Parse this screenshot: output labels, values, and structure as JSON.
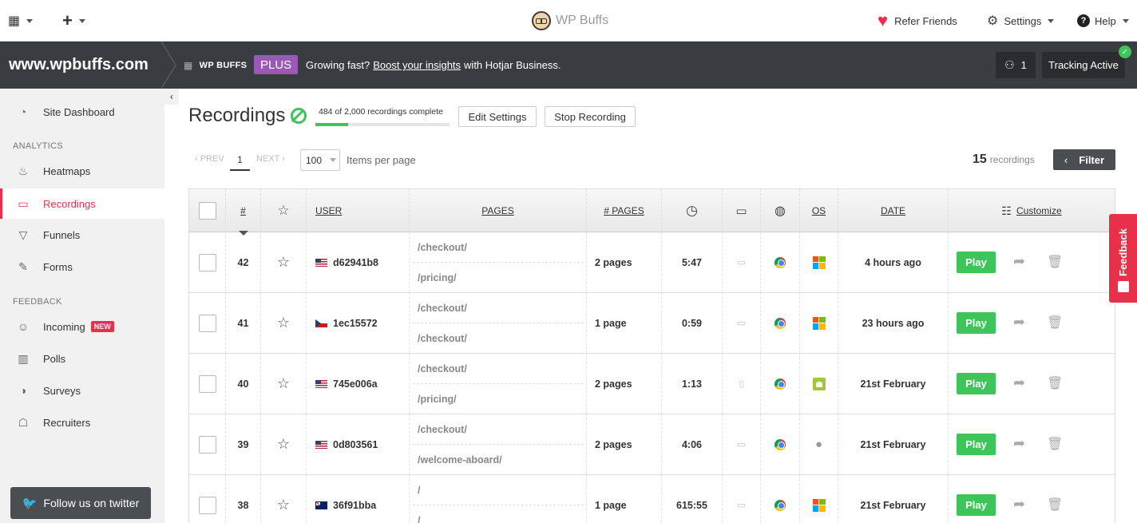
{
  "topbar": {
    "logo_text": "WP Buffs",
    "refer_label": "Refer Friends",
    "settings_label": "Settings",
    "help_label": "Help"
  },
  "sitebar": {
    "site_name": "www.wpbuffs.com",
    "org_name": "WP BUFFS",
    "plan_badge": "PLUS",
    "promo_prefix": "Growing fast?",
    "promo_link": "Boost your insights",
    "promo_suffix": "with Hotjar Business.",
    "active_users": "1",
    "tracking_label": "Tracking Active"
  },
  "sidebar": {
    "dashboard": "Site Dashboard",
    "analytics_head": "ANALYTICS",
    "heatmaps": "Heatmaps",
    "recordings": "Recordings",
    "funnels": "Funnels",
    "forms": "Forms",
    "feedback_head": "FEEDBACK",
    "incoming": "Incoming",
    "new_badge": "NEW",
    "polls": "Polls",
    "surveys": "Surveys",
    "recruiters": "Recruiters",
    "twitter": "Follow us on twitter"
  },
  "main": {
    "title": "Recordings",
    "progress_text": "484 of 2,000 recordings complete",
    "progress_fraction": 0.242,
    "edit_settings": "Edit Settings",
    "stop_recording": "Stop Recording"
  },
  "pagination": {
    "prev": "‹ PREV",
    "page": "1",
    "next": "NEXT ›",
    "per_page": "100",
    "per_page_label": "Items per page",
    "count": "15",
    "count_label": "recordings",
    "filter": "Filter"
  },
  "table": {
    "headers": {
      "num": "#",
      "user": "USER",
      "pages": "PAGES",
      "num_pages": "# PAGES",
      "os": "OS",
      "date": "DATE",
      "customize": "Customize"
    },
    "play_label": "Play",
    "rows": [
      {
        "num": "42",
        "flag": "us",
        "user": "d62941b8",
        "page1": "/checkout/",
        "page2": "/pricing/",
        "page_count": "2 pages",
        "duration": "5:47",
        "device": "desktop",
        "browser": "chrome",
        "os": "windows",
        "date": "4 hours ago"
      },
      {
        "num": "41",
        "flag": "cz",
        "user": "1ec15572",
        "page1": "/checkout/",
        "page2": "/checkout/",
        "page_count": "1 page",
        "duration": "0:59",
        "device": "desktop",
        "browser": "chrome",
        "os": "windows",
        "date": "23 hours ago"
      },
      {
        "num": "40",
        "flag": "us",
        "user": "745e006a",
        "page1": "/checkout/",
        "page2": "/pricing/",
        "page_count": "2 pages",
        "duration": "1:13",
        "device": "mobile",
        "browser": "chrome",
        "os": "android",
        "date": "21st February"
      },
      {
        "num": "39",
        "flag": "us",
        "user": "0d803561",
        "page1": "/checkout/",
        "page2": "/welcome-aboard/",
        "page_count": "2 pages",
        "duration": "4:06",
        "device": "desktop",
        "browser": "chrome",
        "os": "apple",
        "date": "21st February"
      },
      {
        "num": "38",
        "flag": "au",
        "user": "36f91bba",
        "page1": "/",
        "page2": "/",
        "page_count": "1 page",
        "duration": "615:55",
        "device": "desktop",
        "browser": "chrome",
        "os": "windows",
        "date": "21st February"
      }
    ]
  },
  "feedback_tab": "Feedback",
  "colors": {
    "accent": "#e8304a",
    "play": "#3ec55a",
    "plan": "#9b59b6",
    "sitebar": "#393c40"
  }
}
